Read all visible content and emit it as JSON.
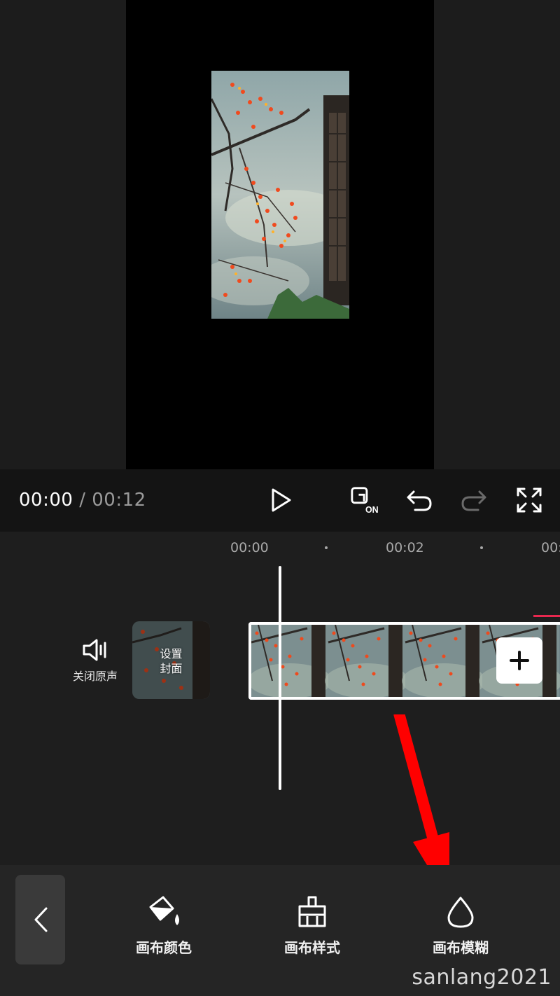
{
  "preview": {
    "image_icon": "persimmon-tree-window-scene"
  },
  "controls": {
    "current_time": "00:00",
    "separator": "/",
    "total_time": "00:12",
    "icons": [
      "play-icon",
      "keyframe-on-icon",
      "undo-icon",
      "redo-icon",
      "fullscreen-icon"
    ],
    "keyframe_badge": "ON"
  },
  "timeline": {
    "ruler": [
      "00:00",
      "00:02",
      "00:0"
    ],
    "mute_label": "关闭原声",
    "cover_label_line1": "设置",
    "cover_label_line2": "封面",
    "add_icon": "plus-icon"
  },
  "toolbar": {
    "back_icon": "chevron-left-icon",
    "items": [
      {
        "label": "画布颜色",
        "icon": "paint-bucket-icon"
      },
      {
        "label": "画布样式",
        "icon": "brush-icon"
      },
      {
        "label": "画布模糊",
        "icon": "drop-icon"
      }
    ]
  },
  "watermark": "sanlang2021",
  "colors": {
    "accent_red": "#e8284f",
    "annotation_arrow": "#ff0000"
  }
}
